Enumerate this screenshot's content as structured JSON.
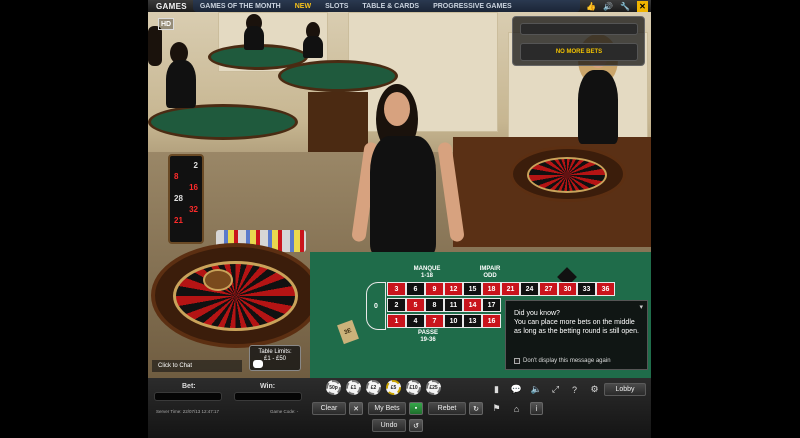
{
  "nav": {
    "brand": "GAMES",
    "items": [
      {
        "label": "GAMES OF THE MONTH",
        "highlight": false
      },
      {
        "label": "NEW",
        "highlight": true
      },
      {
        "label": "SLOTS",
        "highlight": false
      },
      {
        "label": "TABLE & CARDS",
        "highlight": false
      },
      {
        "label": "PROGRESSIVE GAMES",
        "highlight": false
      }
    ]
  },
  "video": {
    "hd_badge": "HD",
    "status": "NO MORE BETS"
  },
  "results": [
    {
      "value": "2",
      "color": "black"
    },
    {
      "value": "8",
      "color": "red"
    },
    {
      "value": "16",
      "color": "red"
    },
    {
      "value": "28",
      "color": "black"
    },
    {
      "value": "32",
      "color": "red"
    },
    {
      "value": "21",
      "color": "red"
    }
  ],
  "felt": {
    "manque": "MANQUE",
    "manque_range": "1-18",
    "impair": "IMPAIR",
    "impair_sub": "ODD",
    "passe": "PASSE",
    "passe_range": "19-36",
    "dealer_sign": "3E",
    "zero": "0",
    "grid_rows": [
      [
        {
          "n": "3",
          "c": "red"
        },
        {
          "n": "6",
          "c": "black"
        },
        {
          "n": "9",
          "c": "red"
        },
        {
          "n": "12",
          "c": "red"
        },
        {
          "n": "15",
          "c": "black"
        },
        {
          "n": "18",
          "c": "red"
        },
        {
          "n": "21",
          "c": "red"
        },
        {
          "n": "24",
          "c": "black"
        },
        {
          "n": "27",
          "c": "red"
        },
        {
          "n": "30",
          "c": "red"
        },
        {
          "n": "33",
          "c": "black"
        },
        {
          "n": "36",
          "c": "red"
        }
      ],
      [
        {
          "n": "2",
          "c": "black"
        },
        {
          "n": "5",
          "c": "red"
        },
        {
          "n": "8",
          "c": "black"
        },
        {
          "n": "11",
          "c": "black"
        },
        {
          "n": "14",
          "c": "red"
        },
        {
          "n": "17",
          "c": "black"
        }
      ],
      [
        {
          "n": "1",
          "c": "red"
        },
        {
          "n": "4",
          "c": "black"
        },
        {
          "n": "7",
          "c": "red"
        },
        {
          "n": "10",
          "c": "black"
        },
        {
          "n": "13",
          "c": "black"
        },
        {
          "n": "16",
          "c": "red"
        }
      ]
    ]
  },
  "tip": {
    "title": "Did you know?",
    "text": "You can place more bets on the middle as long as the betting round is still open.",
    "checkbox_label": "Don't display this message again"
  },
  "chat_label": "Click to Chat",
  "limits": {
    "title": "Table Limits:",
    "range": "£1 - £50"
  },
  "bottom": {
    "bet_label": "Bet:",
    "win_label": "Win:",
    "server_time": "Server Time: 22/07/13 12:47:17",
    "game_code": "Game Code: -",
    "chips": [
      "50p",
      "£1",
      "£2",
      "£5",
      "£10",
      "£25"
    ],
    "clear_label": "Clear",
    "mybets_label": "My Bets",
    "rebet_label": "Rebet",
    "undo_label": "Undo",
    "lobby_label": "Lobby"
  },
  "colors": {
    "accent": "#f7c21a",
    "felt": "#1f6c4a",
    "red": "#c9141c"
  }
}
